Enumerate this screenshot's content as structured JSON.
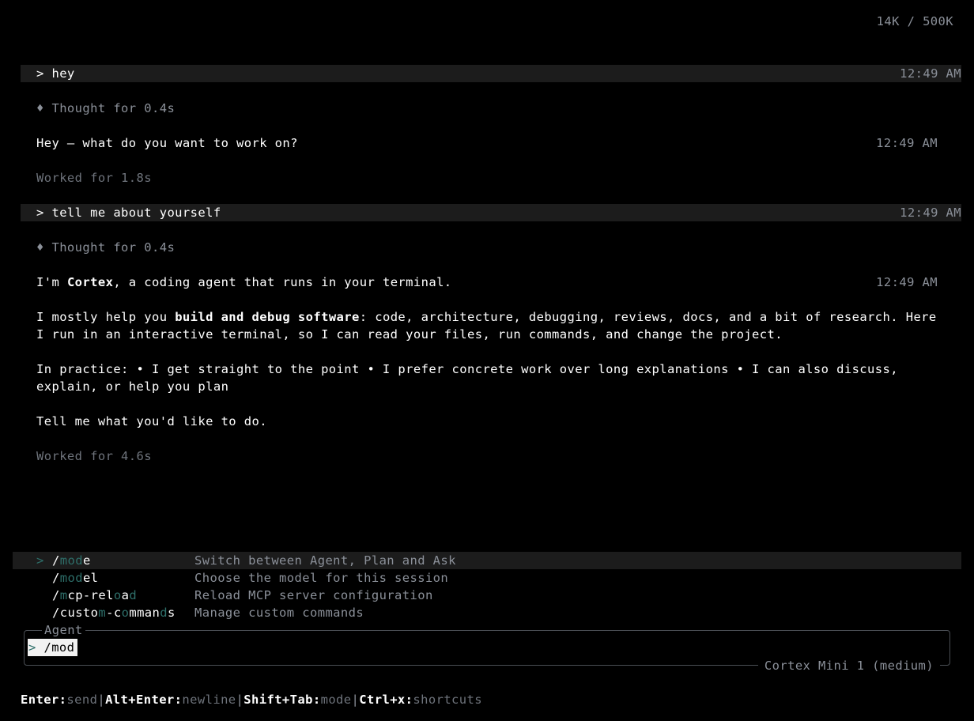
{
  "header": {
    "token_usage": "14K / 500K"
  },
  "messages": [
    {
      "user": "> hey",
      "user_time": "12:49 AM",
      "thought": "♦ Thought for 0.4s",
      "reply": "Hey — what do you want to work on?",
      "reply_time": "12:49 AM",
      "worked": "Worked for 1.8s"
    },
    {
      "user": "> tell me about yourself",
      "user_time": "12:49 AM",
      "thought": "♦ Thought for 0.4s",
      "reply_pre": "I'm ",
      "reply_bold": "Cortex",
      "reply_post": ", a coding agent that runs in your terminal.",
      "reply_time": "12:49 AM",
      "para1_pre": "I mostly help you ",
      "para1_bold": "build and debug software",
      "para1_post": ": code, architecture, debugging, reviews, docs, and a bit of research. Here I run in an interactive terminal, so I can read your files, run commands, and change the project.",
      "para2": "In practice: • I get straight to the point • I prefer concrete work over long explanations • I can also discuss, explain, or help you plan",
      "para3": "Tell me what you'd like to do.",
      "worked": "Worked for 4.6s"
    }
  ],
  "suggestions": [
    {
      "pointer": ">",
      "cmd": "/mode",
      "desc": "Switch between Agent, Plan and Ask",
      "selected": true
    },
    {
      "cmd": "/model",
      "desc": "Choose the model for this session"
    },
    {
      "cmd": "/mcp-reload",
      "desc": "Reload MCP server configuration"
    },
    {
      "cmd": "/custom-commands",
      "desc": "Manage custom commands"
    }
  ],
  "input": {
    "mode_label": "Agent",
    "prompt": ">",
    "value": "/mod",
    "model": "Cortex Mini 1 (medium)"
  },
  "footer": [
    {
      "key": "Enter:",
      "value": "send"
    },
    {
      "key": "Alt+Enter:",
      "value": "newline"
    },
    {
      "key": "Shift+Tab:",
      "value": "mode"
    },
    {
      "key": "Ctrl+x:",
      "value": "shortcuts"
    }
  ],
  "footer_sep": "|",
  "colors": {
    "background": "#000000",
    "match_highlight": "#2e6f6a",
    "user_bar": "#1c1c1c"
  }
}
